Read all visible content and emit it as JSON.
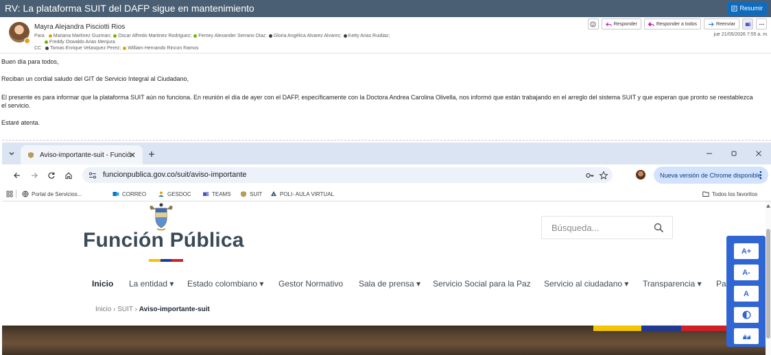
{
  "outlook": {
    "subject": "RV: La plataforma SUIT del DAFP sigue en mantenimiento",
    "summarize_label": "Resumir",
    "sender": "Mayra Alejandra Pisciotti Rios",
    "to_label": "Para",
    "to_recipients": [
      "Mariana Martinez Guzman;",
      "Oscar Alfredo Martinez Rodriguez;",
      "Ferney Alexander Serrano Diaz;",
      "Gloria Angélica Alvarez Alvarez;",
      "Ketty Arias Ruidiaz;",
      "Freddy Oswaldo Arias Menjura"
    ],
    "cc_label": "CC",
    "cc_recipients": [
      "Tomas Enrique Velasquez Perez;",
      "William Hernando Rincon Ramos"
    ],
    "actions": {
      "reply": "Responder",
      "reply_all": "Responder a todos",
      "forward": "Reenviar"
    },
    "date": "jue 21/05/2026 7:55 a. m.",
    "body": {
      "greeting": "Buen día para todos,",
      "line1": "Reciban un cordial saludo del GIT de Servicio Integral al Ciudadano,",
      "line2a": "El presente es para informar que la plataforma SUIT aún no funciona. En reunión el día de ayer con el DAFP, específicamente con la Doctora Andrea Carolina Olivella, nos informó que están trabajando en el arreglo del sistema SUIT y que esperan que pronto se reestablezca",
      "line2b": "el servicio.",
      "closing": "Estaré atenta."
    }
  },
  "browser": {
    "tab_title": "Aviso-importante-suit - Funció",
    "url": "funcionpublica.gov.co/suit/aviso-importante",
    "update_label": "Nueva versión de Chrome disponible",
    "bookmarks": [
      "Portal de Servicios...",
      "CORREO",
      "GESDOC",
      "TEAMS",
      "SUIT",
      "POLI- AULA VIRTUAL"
    ],
    "all_bookmarks": "Todos los favoritos"
  },
  "site": {
    "brand": "Función Pública",
    "search_placeholder": "Búsqueda...",
    "nav": [
      "Inicio",
      "La entidad ▾",
      "Estado colombiano ▾",
      "Gestor Normativo",
      "Sala de prensa ▾",
      "Servicio Social para la Paz",
      "Servicio al ciudadano ▾",
      "Transparencia ▾",
      "Par"
    ],
    "breadcrumb": {
      "home": "Inicio",
      "section": "SUIT",
      "current": "Aviso-importante-suit"
    },
    "accessibility": [
      "A+",
      "A-",
      "A"
    ]
  },
  "colors": {
    "outlook_titlebar": "#4a5f73",
    "accent_blue": "#0f6cbd",
    "access_panel": "#2f66d4",
    "flag_yellow": "#f5c400",
    "flag_blue": "#1f3a93",
    "flag_red": "#d21f26"
  }
}
